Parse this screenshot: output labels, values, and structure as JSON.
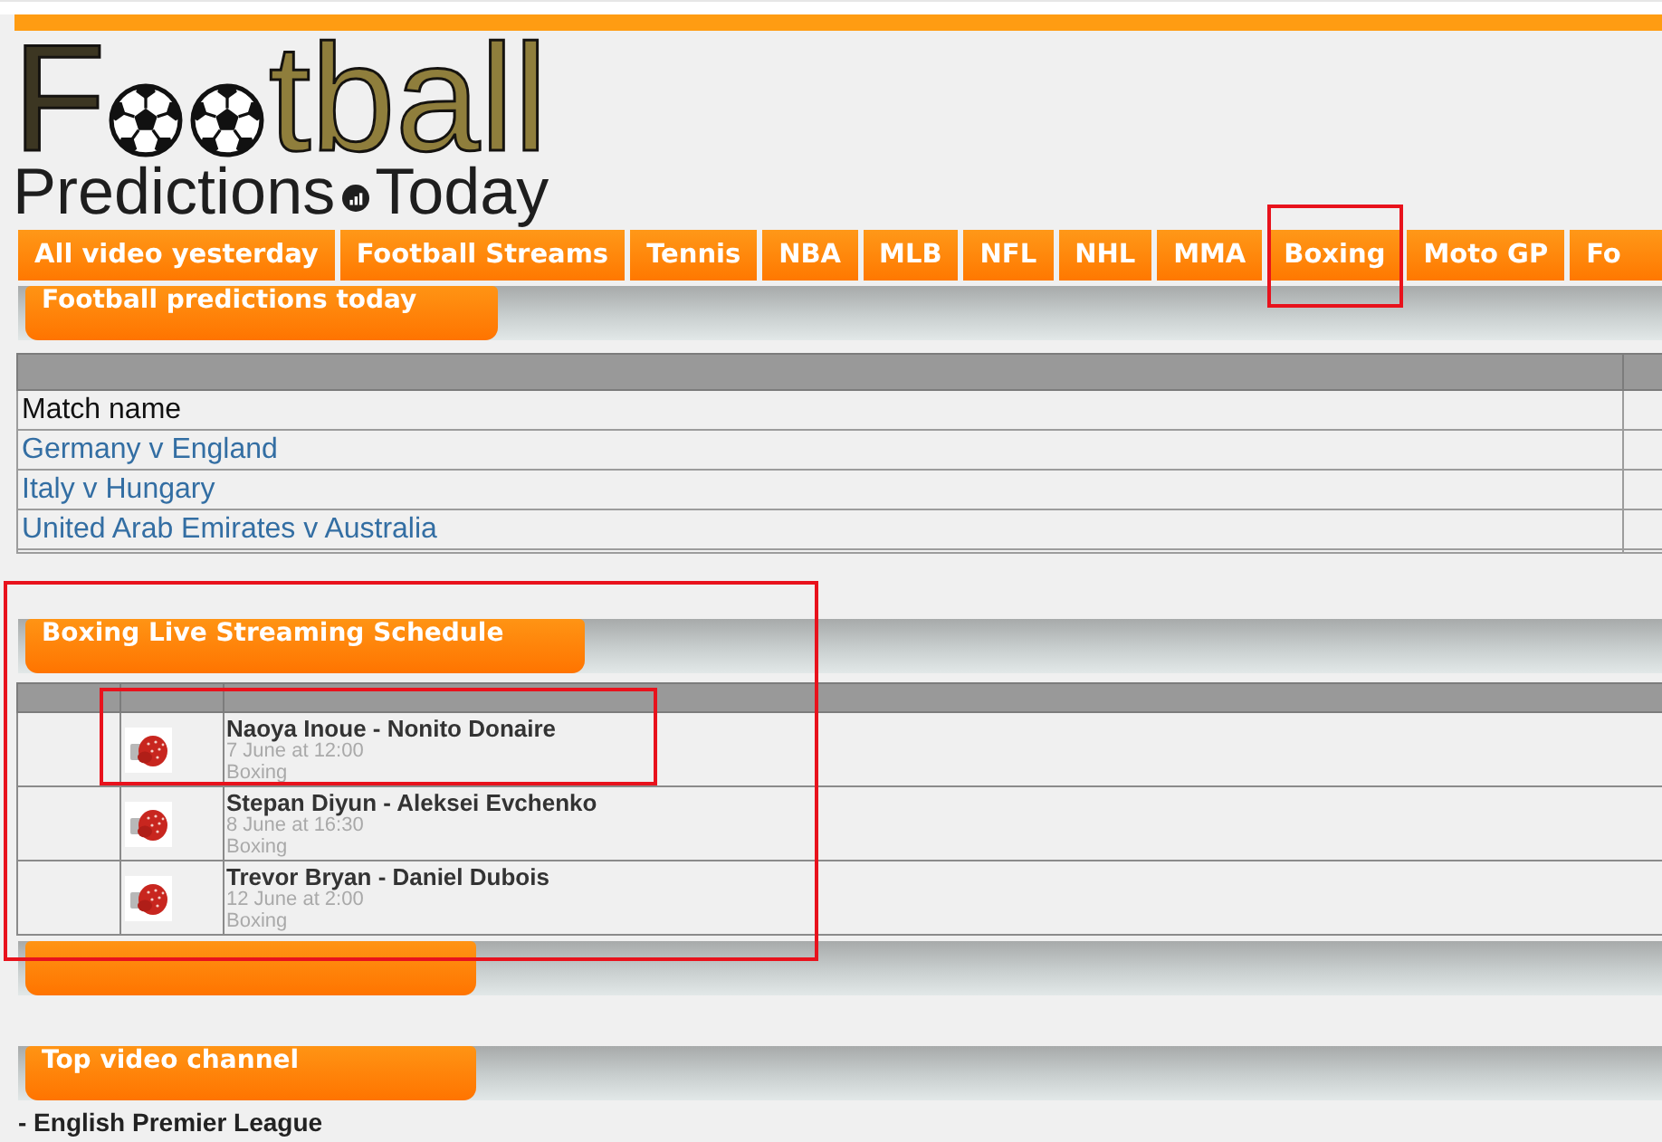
{
  "logo": {
    "title_parts": [
      "F",
      "tball"
    ],
    "subtitle_parts": [
      "Predictions",
      "Today"
    ]
  },
  "nav_tabs": [
    {
      "label": "All video yesterday",
      "highlighted": false
    },
    {
      "label": "Football Streams",
      "highlighted": false
    },
    {
      "label": "Tennis",
      "highlighted": false
    },
    {
      "label": "NBA",
      "highlighted": false
    },
    {
      "label": "MLB",
      "highlighted": false
    },
    {
      "label": "NFL",
      "highlighted": false
    },
    {
      "label": "NHL",
      "highlighted": false
    },
    {
      "label": "MMA",
      "highlighted": false
    },
    {
      "label": "Boxing",
      "highlighted": true
    },
    {
      "label": "Moto GP",
      "highlighted": false
    },
    {
      "label": "Fo",
      "highlighted": false
    }
  ],
  "sections": [
    {
      "kind": "match_list",
      "title": "Football predictions today",
      "highlighted": false,
      "columns": [
        "Match name"
      ],
      "rows": [
        {
          "match": "Germany v England"
        },
        {
          "match": "Italy v Hungary"
        },
        {
          "match": "United Arab Emirates v Australia"
        }
      ]
    },
    {
      "kind": "schedule",
      "title": "Boxing Live Streaming Schedule",
      "highlighted": true,
      "events": [
        {
          "title": "Naoya Inoue - Nonito Donaire",
          "time": "7 June at 12:00",
          "sport": "Boxing",
          "highlighted": true
        },
        {
          "title": "Stepan Diyun - Aleksei Evchenko",
          "time": "8 June at 16:30",
          "sport": "Boxing",
          "highlighted": false
        },
        {
          "title": "Trevor Bryan - Daniel Dubois",
          "time": "12 June at 2:00",
          "sport": "Boxing",
          "highlighted": false
        }
      ]
    },
    {
      "kind": "blank",
      "highlighted": false
    },
    {
      "kind": "channel_list",
      "title": "Top video channel",
      "highlighted": false,
      "items": [
        "- English Premier League"
      ]
    }
  ]
}
